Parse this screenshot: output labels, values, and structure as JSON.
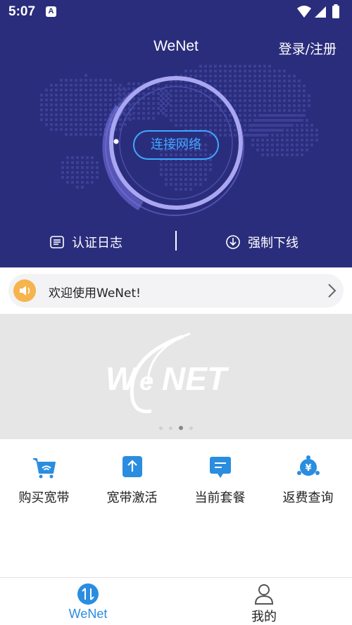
{
  "status_bar": {
    "time": "5:07",
    "notification_icon": "a-icon",
    "icons": [
      "wifi-icon",
      "signal-icon",
      "battery-icon"
    ]
  },
  "header": {
    "title": "WeNet",
    "login_label": "登录/注册",
    "connect_label": "连接网络",
    "auth_log_label": "认证日志",
    "force_offline_label": "强制下线",
    "background_color": "#2a2d7c"
  },
  "notice": {
    "text": "欢迎使用WeNet!",
    "icon": "speaker-icon",
    "icon_color": "#f6b44d"
  },
  "banner": {
    "logo_icon": "wenet-logo",
    "page_count": 4,
    "active_page": 3
  },
  "shortcuts": [
    {
      "label": "购买宽带",
      "icon": "cart-icon"
    },
    {
      "label": "宽带激活",
      "icon": "upload-icon"
    },
    {
      "label": "当前套餐",
      "icon": "package-icon"
    },
    {
      "label": "返费查询",
      "icon": "refund-icon"
    }
  ],
  "tabs": [
    {
      "label": "WeNet",
      "icon": "wenet-tab-icon",
      "active": true
    },
    {
      "label": "我的",
      "icon": "person-icon",
      "active": false
    }
  ],
  "colors": {
    "accent": "#2a8de0",
    "connect_button": "#3ea8ff",
    "ring": "#a9a6f2"
  }
}
